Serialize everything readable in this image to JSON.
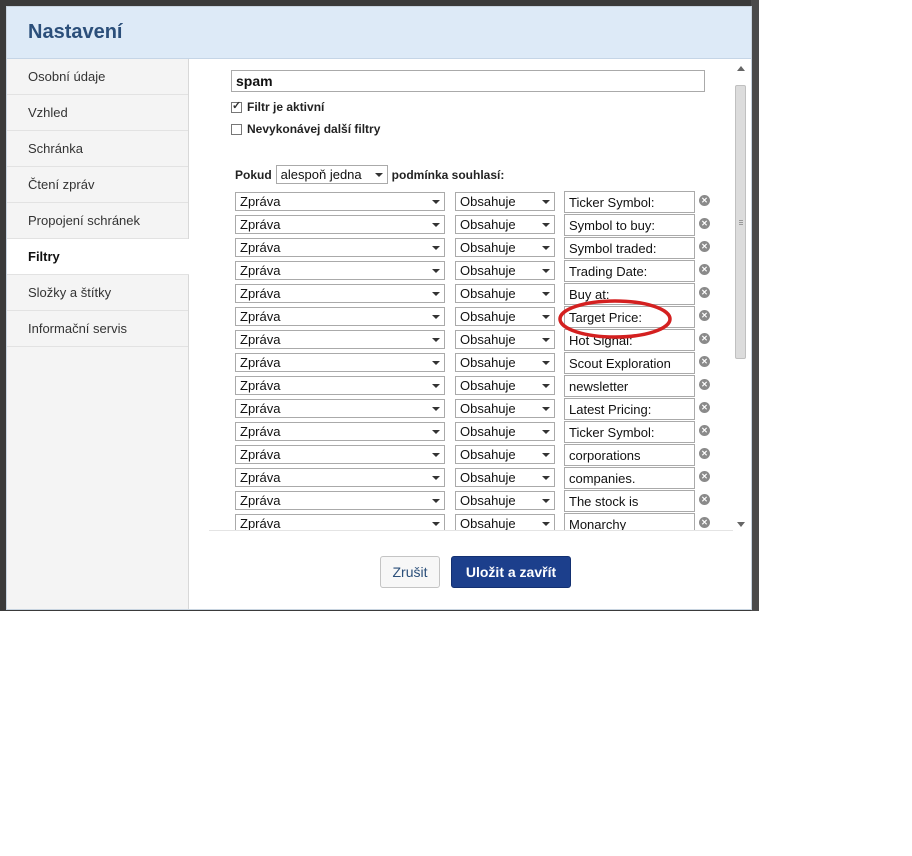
{
  "dialog": {
    "title": "Nastavení"
  },
  "sidebar": {
    "items": [
      {
        "label": "Osobní údaje"
      },
      {
        "label": "Vzhled"
      },
      {
        "label": "Schránka"
      },
      {
        "label": "Čtení zpráv"
      },
      {
        "label": "Propojení schránek"
      },
      {
        "label": "Filtry",
        "active": true
      },
      {
        "label": "Složky a štítky"
      },
      {
        "label": "Informační servis"
      }
    ]
  },
  "filter": {
    "name": "spam",
    "active_label": "Filtr je aktivní",
    "active_checked": true,
    "stop_label": "Nevykonávej další filtry",
    "stop_checked": false,
    "condition_prefix": "Pokud",
    "condition_mode": "alespoň jedna",
    "condition_suffix": "podmínka souhlasí:",
    "rules": [
      {
        "field": "Zpráva",
        "op": "Obsahuje",
        "value": "Ticker Symbol:"
      },
      {
        "field": "Zpráva",
        "op": "Obsahuje",
        "value": "Symbol to buy:"
      },
      {
        "field": "Zpráva",
        "op": "Obsahuje",
        "value": "Symbol traded:"
      },
      {
        "field": "Zpráva",
        "op": "Obsahuje",
        "value": "Trading Date:"
      },
      {
        "field": "Zpráva",
        "op": "Obsahuje",
        "value": "Buy at:"
      },
      {
        "field": "Zpráva",
        "op": "Obsahuje",
        "value": "Target Price:"
      },
      {
        "field": "Zpráva",
        "op": "Obsahuje",
        "value": "Hot Signal:"
      },
      {
        "field": "Zpráva",
        "op": "Obsahuje",
        "value": "Scout Exploration"
      },
      {
        "field": "Zpráva",
        "op": "Obsahuje",
        "value": "newsletter"
      },
      {
        "field": "Zpráva",
        "op": "Obsahuje",
        "value": "Latest Pricing:"
      },
      {
        "field": "Zpráva",
        "op": "Obsahuje",
        "value": "Ticker Symbol:"
      },
      {
        "field": "Zpráva",
        "op": "Obsahuje",
        "value": "corporations"
      },
      {
        "field": "Zpráva",
        "op": "Obsahuje",
        "value": "companies."
      },
      {
        "field": "Zpráva",
        "op": "Obsahuje",
        "value": "The stock is"
      },
      {
        "field": "Zpráva",
        "op": "Obsahuje",
        "value": "Monarchy"
      }
    ]
  },
  "buttons": {
    "cancel": "Zrušit",
    "save": "Uložit a zavřít"
  },
  "colors": {
    "header_bg": "#ddeaf7",
    "title": "#2b4f7a",
    "save_button": "#1c3f8c",
    "annotation": "#d42020"
  }
}
